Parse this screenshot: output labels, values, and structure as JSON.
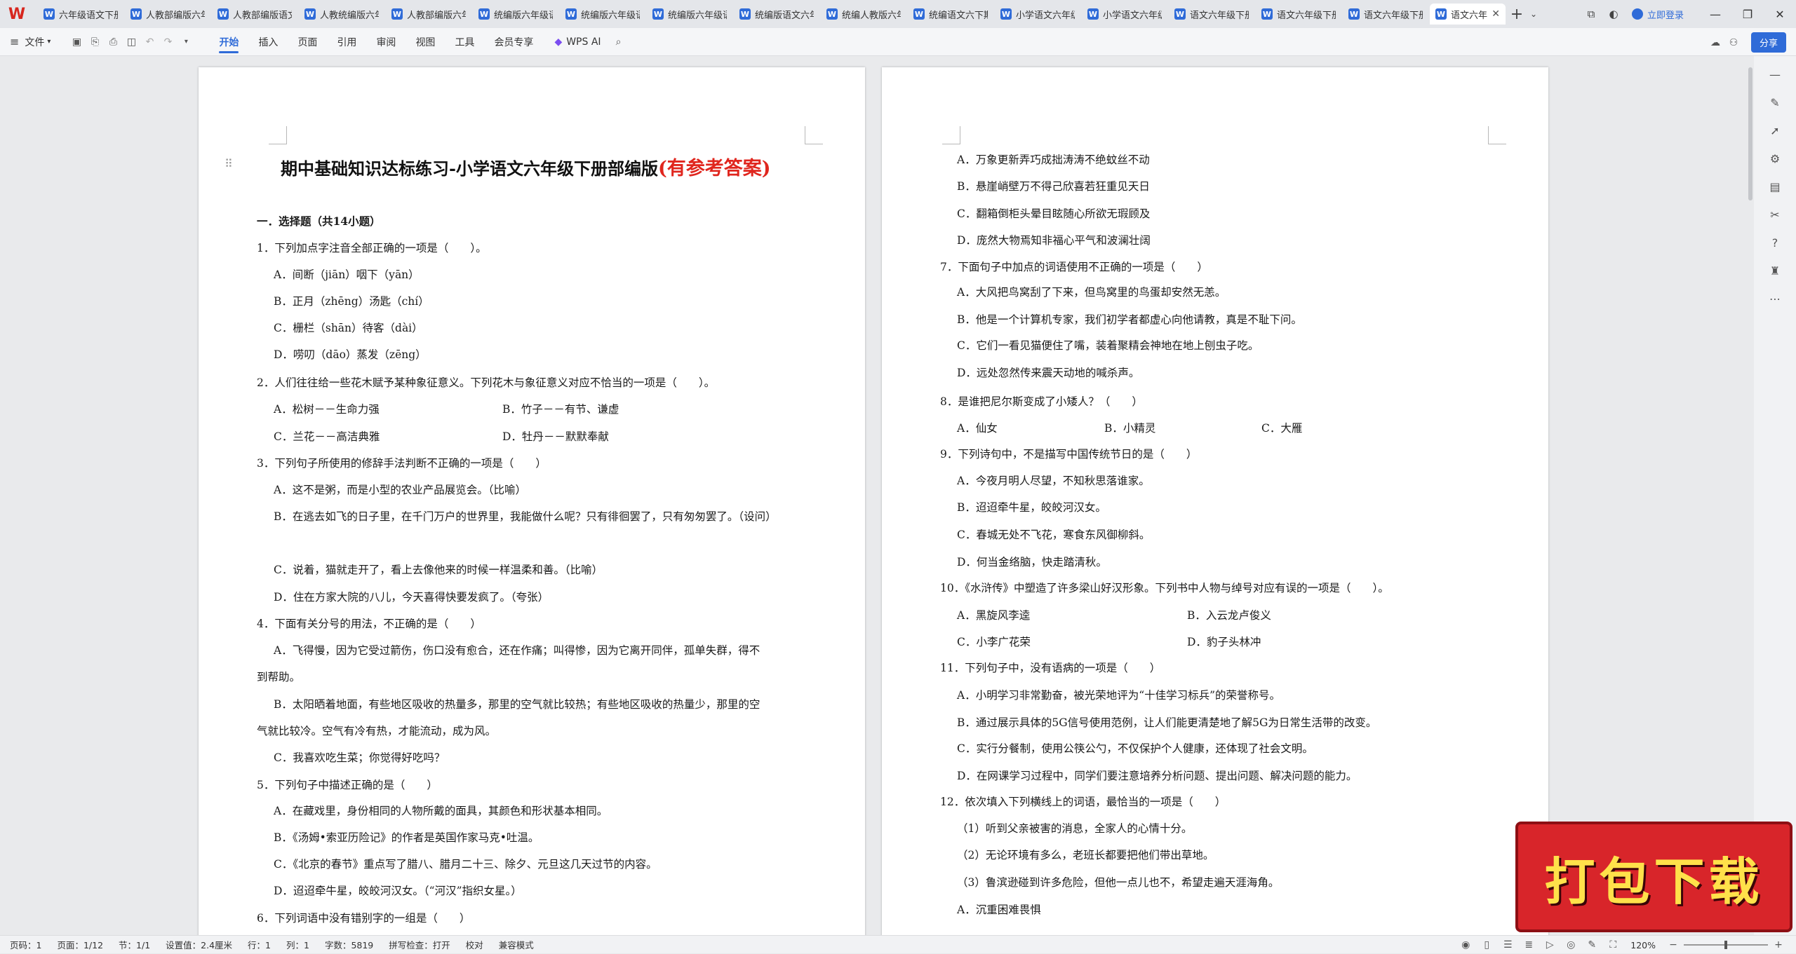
{
  "tabbar": {
    "logo": "W",
    "tabs": [
      "六年级语文下册",
      "人教部编版六年",
      "人教部编版语文",
      "人教统编版六年",
      "人教部编版六年",
      "统编版六年级语",
      "统编版六年级语",
      "统编版六年级语",
      "统编版语文六年",
      "统编人教版六年",
      "统编语文六下期",
      "小学语文六年级",
      "小学语文六年级",
      "语文六年级下册",
      "语文六年级下册",
      "语文六年级下册"
    ],
    "active_tab": "语文六年",
    "login": "立即登录"
  },
  "ribbon": {
    "file_menu": "文件",
    "tabs": [
      "开始",
      "插入",
      "页面",
      "引用",
      "审阅",
      "视图",
      "工具",
      "会员专享"
    ],
    "active_tab": "开始",
    "wps_ai": "WPS AI",
    "share": "分享"
  },
  "document": {
    "title_main": "期中基础知识达标练习-小学语文六年级下册部编版",
    "title_red": "(有参考答案)",
    "left_page": [
      "一．选择题（共14小题）",
      "1．下列加点字注音全部正确的一项是（　　）。",
      "A．间断（jiān）咽下（yān）",
      "B．正月（zhēng）汤匙（chí）",
      "C．栅栏（shān）待客（dài）",
      "D．唠叨（dāo）蒸发（zēng）",
      "2．人们往往给一些花木赋予某种象征意义。下列花木与象征意义对应不恰当的一项是（　　）。",
      "A．松树－－生命力强",
      "B．竹子－－有节、谦虚",
      "C．兰花－－高洁典雅",
      "D．牡丹－－默默奉献",
      "3．下列句子所使用的修辞手法判断不正确的一项是（　　）",
      "A．这不是粥，而是小型的农业产品展览会。（比喻）",
      "B．在逃去如飞的日子里，在千门万户的世界里，我能做什么呢？只有徘徊罢了，只有匆匆罢了。（设问）",
      "C．说着，猫就走开了，看上去像他来的时候一样温柔和善。（比喻）",
      "D．住在方家大院的八儿，今天喜得快要发疯了。（夸张）",
      "4．下面有关分号的用法，不正确的是（　　）",
      "A．飞得慢，因为它受过箭伤，伤口没有愈合，还在作痛；叫得惨，因为它离开同伴，孤单失群，得不",
      "到帮助。",
      "B．太阳晒着地面，有些地区吸收的热量多，那里的空气就比较热；有些地区吸收的热量少，那里的空",
      "气就比较冷。空气有冷有热，才能流动，成为风。",
      "C．我喜欢吃生菜；你觉得好吃吗？",
      "5．下列句子中描述正确的是（　　）",
      "A．在藏戏里，身份相同的人物所戴的面具，其颜色和形状基本相同。",
      "B．《汤姆•索亚历险记》的作者是英国作家马克•吐温。",
      "C．《北京的春节》重点写了腊八、腊月二十三、除夕、元旦这几天过节的内容。",
      "D．迢迢牵牛星，皎皎河汉女。（“河汉”指织女星。）",
      "6．下列词语中没有错别字的一组是（　　）"
    ],
    "right_page": [
      "A．万象更新弄巧成拙涛涛不绝蚊丝不动",
      "B．悬崖峭壁万不得己欣喜若狂重见天日",
      "C．翻箱倒柜头晕目眩随心所欲无瑕顾及",
      "D．庞然大物焉知非福心平气和波澜壮阔",
      "7．下面句子中加点的词语使用不正确的一项是（　　）",
      "A．大风把鸟窝刮了下来，但鸟窝里的鸟蛋却安然无恙。",
      "B．他是一个计算机专家，我们初学者都虚心向他请教，真是不耻下问。",
      "C．它们一看见猫便住了嘴，装着聚精会神地在地上刨虫子吃。",
      "D．远处忽然传来震天动地的喊杀声。",
      "8．是谁把尼尔斯变成了小矮人？（　　）",
      "A．仙女",
      "B．小精灵",
      "C．大雁",
      "9．下列诗句中，不是描写中国传统节日的是（　　）",
      "A．今夜月明人尽望，不知秋思落谁家。",
      "B．迢迢牵牛星，皎皎河汉女。",
      "C．春城无处不飞花，寒食东风御柳斜。",
      "D．何当金络脑，快走踏清秋。",
      "10．《水浒传》中塑造了许多梁山好汉形象。下列书中人物与绰号对应有误的一项是（　　）。",
      "A．黑旋风李逵",
      "B．入云龙卢俊义",
      "C．小李广花荣",
      "D．豹子头林冲",
      "11．下列句子中，没有语病的一项是（　　）",
      "A．小明学习非常勤奋，被光荣地评为“十佳学习标兵”的荣誉称号。",
      "B．通过展示具体的5G信号使用范例，让人们能更清楚地了解5G为日常生活带的改变。",
      "C．实行分餐制，使用公筷公勺，不仅保护个人健康，还体现了社会文明。",
      "D．在网课学习过程中，同学们要注意培养分析问题、提出问题、解决问题的能力。",
      "12．依次填入下列横线上的词语，最恰当的一项是（　　）",
      "（1）听到父亲被害的消息，全家人的心情十分。",
      "（2）无论环境有多么，老班长都要把他们带出草地。",
      "（3）鲁滨逊碰到许多危险，但他一点儿也不，希望走遍天涯海角。",
      "A．沉重困难畏惧"
    ]
  },
  "banner": "打包下载",
  "status": {
    "page": "页码：1",
    "pages": "页面：1/12",
    "section": "节：1/1",
    "setting": "设置值：2.4厘米",
    "row": "行：1",
    "col": "列：1",
    "words": "字数：5819",
    "spell": "拼写检查：打开",
    "proof": "校对",
    "compat": "兼容模式",
    "zoom": "120%"
  }
}
